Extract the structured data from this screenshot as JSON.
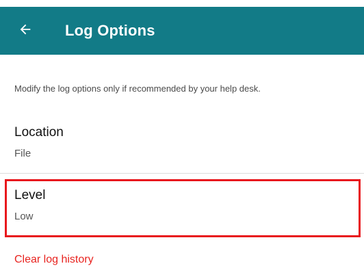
{
  "appbar": {
    "back_icon": "arrow-left-icon",
    "title": "Log Options",
    "background_color": "#127b87"
  },
  "notice": "Modify the log options only if recommended by your help desk.",
  "options": [
    {
      "label": "Location",
      "value": "File"
    },
    {
      "label": "Level",
      "value": "Low"
    }
  ],
  "actions": {
    "clear_log_history": "Clear log history",
    "link_color": "#e8231f"
  },
  "highlight_color": "#e8171c"
}
